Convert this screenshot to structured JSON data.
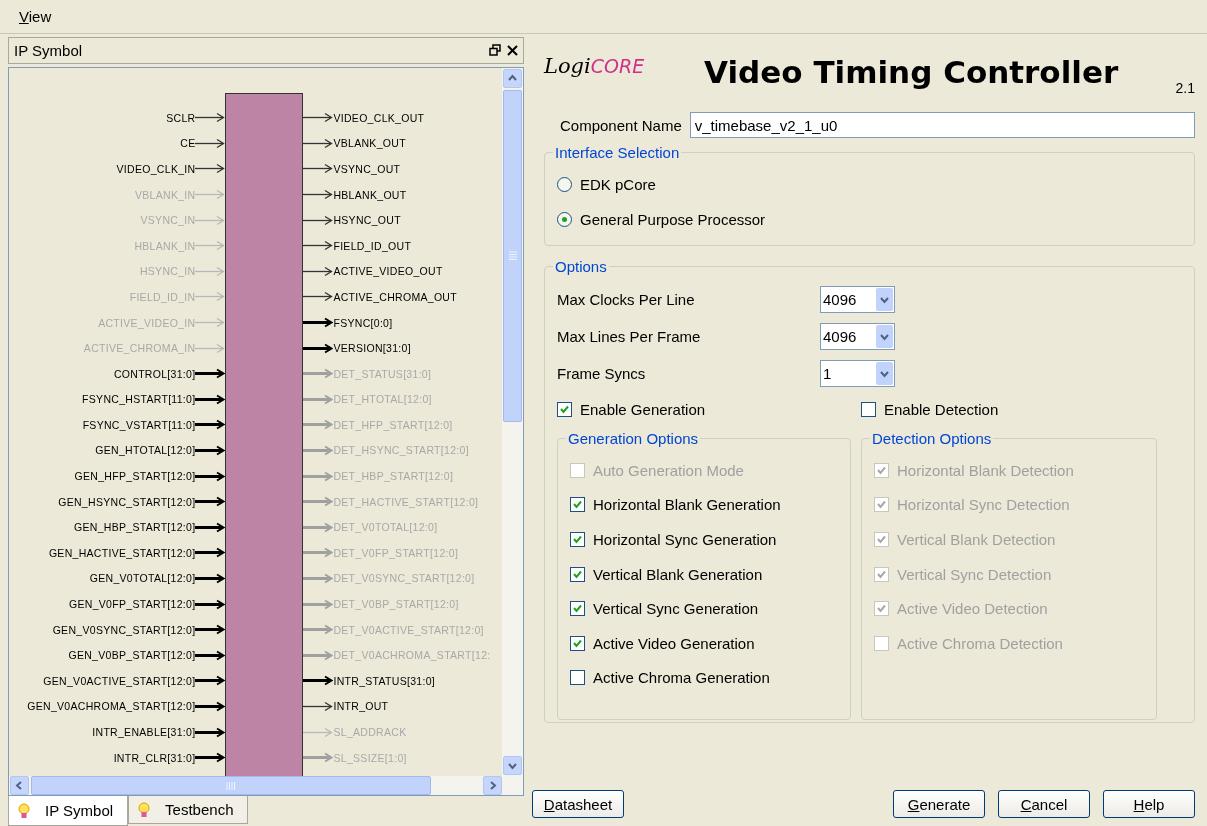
{
  "menu": [
    {
      "label": "View"
    }
  ],
  "panel": {
    "title": "IP Symbol"
  },
  "symbol": {
    "left_pins": [
      {
        "label": "SCLR",
        "bus": false,
        "active": true
      },
      {
        "label": "CE",
        "bus": false,
        "active": true
      },
      {
        "label": "VIDEO_CLK_IN",
        "bus": false,
        "active": true
      },
      {
        "label": "VBLANK_IN",
        "bus": false,
        "active": false
      },
      {
        "label": "VSYNC_IN",
        "bus": false,
        "active": false
      },
      {
        "label": "HBLANK_IN",
        "bus": false,
        "active": false
      },
      {
        "label": "HSYNC_IN",
        "bus": false,
        "active": false
      },
      {
        "label": "FIELD_ID_IN",
        "bus": false,
        "active": false
      },
      {
        "label": "ACTIVE_VIDEO_IN",
        "bus": false,
        "active": false
      },
      {
        "label": "ACTIVE_CHROMA_IN",
        "bus": false,
        "active": false
      },
      {
        "label": "CONTROL[31:0]",
        "bus": true,
        "active": true
      },
      {
        "label": "FSYNC_HSTART[11:0]",
        "bus": true,
        "active": true
      },
      {
        "label": "FSYNC_VSTART[11:0]",
        "bus": true,
        "active": true
      },
      {
        "label": "GEN_HTOTAL[12:0]",
        "bus": true,
        "active": true
      },
      {
        "label": "GEN_HFP_START[12:0]",
        "bus": true,
        "active": true
      },
      {
        "label": "GEN_HSYNC_START[12:0]",
        "bus": true,
        "active": true
      },
      {
        "label": "GEN_HBP_START[12:0]",
        "bus": true,
        "active": true
      },
      {
        "label": "GEN_HACTIVE_START[12:0]",
        "bus": true,
        "active": true
      },
      {
        "label": "GEN_V0TOTAL[12:0]",
        "bus": true,
        "active": true
      },
      {
        "label": "GEN_V0FP_START[12:0]",
        "bus": true,
        "active": true
      },
      {
        "label": "GEN_V0SYNC_START[12:0]",
        "bus": true,
        "active": true
      },
      {
        "label": "GEN_V0BP_START[12:0]",
        "bus": true,
        "active": true
      },
      {
        "label": "GEN_V0ACTIVE_START[12:0]",
        "bus": true,
        "active": true
      },
      {
        "label": "GEN_V0ACHROMA_START[12:0]",
        "bus": true,
        "active": true
      },
      {
        "label": "INTR_ENABLE[31:0]",
        "bus": true,
        "active": true
      },
      {
        "label": "INTR_CLR[31:0]",
        "bus": true,
        "active": true
      }
    ],
    "right_pins": [
      {
        "label": "VIDEO_CLK_OUT",
        "bus": false,
        "active": true
      },
      {
        "label": "VBLANK_OUT",
        "bus": false,
        "active": true
      },
      {
        "label": "VSYNC_OUT",
        "bus": false,
        "active": true
      },
      {
        "label": "HBLANK_OUT",
        "bus": false,
        "active": true
      },
      {
        "label": "HSYNC_OUT",
        "bus": false,
        "active": true
      },
      {
        "label": "FIELD_ID_OUT",
        "bus": false,
        "active": true
      },
      {
        "label": "ACTIVE_VIDEO_OUT",
        "bus": false,
        "active": true
      },
      {
        "label": "ACTIVE_CHROMA_OUT",
        "bus": false,
        "active": true
      },
      {
        "label": "FSYNC[0:0]",
        "bus": true,
        "active": true
      },
      {
        "label": "VERSION[31:0]",
        "bus": true,
        "active": true
      },
      {
        "label": "DET_STATUS[31:0]",
        "bus": true,
        "active": false
      },
      {
        "label": "DET_HTOTAL[12:0]",
        "bus": true,
        "active": false
      },
      {
        "label": "DET_HFP_START[12:0]",
        "bus": true,
        "active": false
      },
      {
        "label": "DET_HSYNC_START[12:0]",
        "bus": true,
        "active": false
      },
      {
        "label": "DET_HBP_START[12:0]",
        "bus": true,
        "active": false
      },
      {
        "label": "DET_HACTIVE_START[12:0]",
        "bus": true,
        "active": false
      },
      {
        "label": "DET_V0TOTAL[12:0]",
        "bus": true,
        "active": false
      },
      {
        "label": "DET_V0FP_START[12:0]",
        "bus": true,
        "active": false
      },
      {
        "label": "DET_V0SYNC_START[12:0]",
        "bus": true,
        "active": false
      },
      {
        "label": "DET_V0BP_START[12:0]",
        "bus": true,
        "active": false
      },
      {
        "label": "DET_V0ACTIVE_START[12:0]",
        "bus": true,
        "active": false
      },
      {
        "label": "DET_V0ACHROMA_START[12:",
        "bus": true,
        "active": false
      },
      {
        "label": "INTR_STATUS[31:0]",
        "bus": true,
        "active": true
      },
      {
        "label": "INTR_OUT",
        "bus": false,
        "active": true
      },
      {
        "label": "SL_ADDRACK",
        "bus": false,
        "active": false
      },
      {
        "label": "SL_SSIZE[1:0]",
        "bus": true,
        "active": false
      }
    ]
  },
  "panel_tabs": [
    {
      "label": "IP Symbol",
      "selected": true
    },
    {
      "label": "Testbench",
      "selected": false
    }
  ],
  "header": {
    "logo_prefix": "Logi",
    "logo_accent": "CORE",
    "title": "Video Timing Controller",
    "version": "2.1"
  },
  "component_name": {
    "label": "Component Name",
    "value": "v_timebase_v2_1_u0"
  },
  "interface_selection": {
    "title": "Interface Selection",
    "options": [
      {
        "label": "EDK pCore",
        "selected": false
      },
      {
        "label": "General Purpose Processor",
        "selected": true
      }
    ]
  },
  "options": {
    "title": "Options",
    "selects": [
      {
        "label": "Max Clocks Per Line",
        "value": "4096"
      },
      {
        "label": "Max Lines Per Frame",
        "value": "4096"
      },
      {
        "label": "Frame Syncs",
        "value": "1"
      }
    ],
    "enable_generation": {
      "label": "Enable Generation",
      "checked": true
    },
    "enable_detection": {
      "label": "Enable Detection",
      "checked": false
    },
    "generation_options": {
      "title": "Generation Options",
      "items": [
        {
          "label": "Auto Generation Mode",
          "checked": false,
          "disabled": true
        },
        {
          "label": "Horizontal Blank Generation",
          "checked": true,
          "disabled": false
        },
        {
          "label": "Horizontal Sync Generation",
          "checked": true,
          "disabled": false
        },
        {
          "label": "Vertical Blank Generation",
          "checked": true,
          "disabled": false
        },
        {
          "label": "Vertical Sync Generation",
          "checked": true,
          "disabled": false
        },
        {
          "label": "Active Video Generation",
          "checked": true,
          "disabled": false
        },
        {
          "label": "Active Chroma Generation",
          "checked": false,
          "disabled": false
        }
      ]
    },
    "detection_options": {
      "title": "Detection Options",
      "items": [
        {
          "label": "Horizontal Blank Detection",
          "checked": true,
          "disabled": true
        },
        {
          "label": "Horizontal Sync Detection",
          "checked": true,
          "disabled": true
        },
        {
          "label": "Vertical Blank Detection",
          "checked": true,
          "disabled": true
        },
        {
          "label": "Vertical Sync Detection",
          "checked": true,
          "disabled": true
        },
        {
          "label": "Active Video Detection",
          "checked": true,
          "disabled": true
        },
        {
          "label": "Active Chroma Detection",
          "checked": false,
          "disabled": true
        }
      ]
    }
  },
  "left_buttons": [
    {
      "label": "Datasheet"
    }
  ],
  "right_buttons": [
    {
      "label": "Generate"
    },
    {
      "label": "Cancel"
    },
    {
      "label": "Help"
    }
  ]
}
